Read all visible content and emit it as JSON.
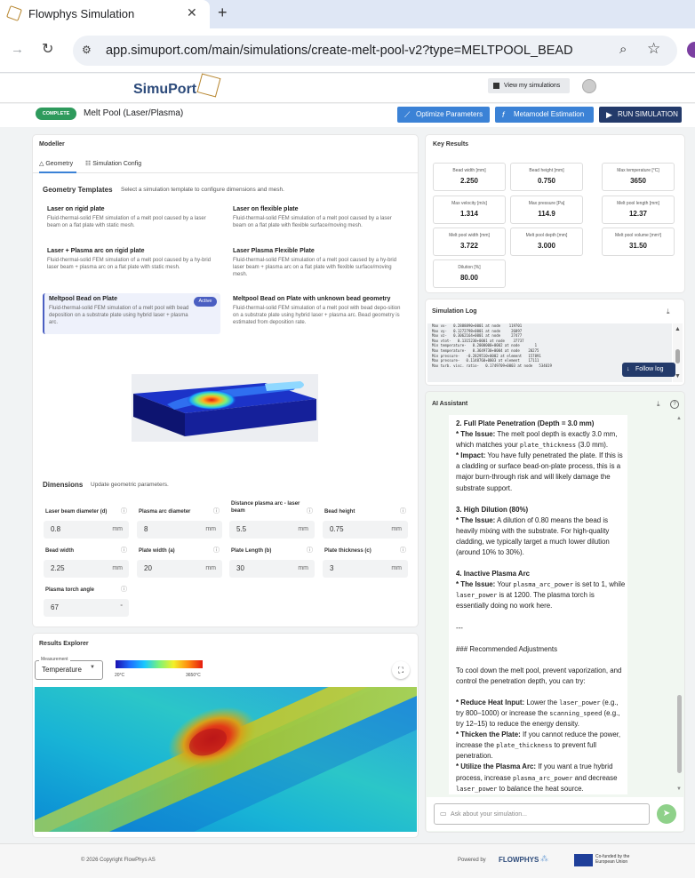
{
  "browser": {
    "tab_title": "Flowphys Simulation",
    "url": "app.simuport.com/main/simulations/create-melt-pool-v2?type=MELTPOOL_BEAD"
  },
  "header": {
    "logo": "SimuPort",
    "view_sims": "View my simulations"
  },
  "subheader": {
    "status": "COMPLETE",
    "name": "Melt Pool (Laser/Plasma)",
    "optimize": "Optimize Parameters",
    "metamodel": "Metamodel Estimation",
    "run": "RUN SIMULATION"
  },
  "modeller": {
    "title": "Modeller",
    "tabs": [
      "Geometry",
      "Simulation Config"
    ],
    "templates_title": "Geometry Templates",
    "templates_desc": "Select a simulation template to configure dimensions and mesh.",
    "templates": [
      {
        "title": "Laser on rigid plate",
        "desc": "Fluid-thermal-solid FEM simulation of a melt pool caused by a laser beam on a flat plate with static mesh."
      },
      {
        "title": "Laser on flexible plate",
        "desc": "Fluid-thermal-solid FEM simulation of a melt pool caused by a laser beam on a flat plate with flexible surface/moving mesh."
      },
      {
        "title": "Laser + Plasma arc on rigid plate",
        "desc": "Fluid-thermal-solid FEM simulation of a melt pool caused by a hy-brid laser beam + plasma arc on a flat plate with static mesh."
      },
      {
        "title": "Laser Plasma Flexible Plate",
        "desc": "Fluid-thermal-solid FEM simulation of a melt pool caused by a hy-brid laser beam + plasma arc on a flat plate with flexible surface/moving mesh."
      },
      {
        "title": "Meltpool Bead on Plate",
        "desc": "Fluid-thermal-solid FEM simulation of a melt pool with bead deposition on a substrate plate using hybrid laser + plasma arc."
      },
      {
        "title": "Meltpool Bead on Plate with unknown bead geometry",
        "desc": "Fluid-thermal-solid FEM simulation of a melt pool with bead depo-sition on a substrate plate using hybrid laser + plasma arc. Bead geometry is estimated from deposition rate."
      }
    ],
    "active_badge": "Active",
    "dims_title": "Dimensions",
    "dims_desc": "Update geometric parameters.",
    "fields": [
      {
        "label": "Laser beam diameter (d)",
        "value": "0.8",
        "unit": "mm"
      },
      {
        "label": "Plasma arc diameter",
        "value": "8",
        "unit": "mm"
      },
      {
        "label": "Distance plasma arc - laser beam",
        "value": "5.5",
        "unit": "mm"
      },
      {
        "label": "Bead height",
        "value": "0.75",
        "unit": "mm"
      },
      {
        "label": "Bead width",
        "value": "2.25",
        "unit": "mm"
      },
      {
        "label": "Plate width (a)",
        "value": "20",
        "unit": "mm"
      },
      {
        "label": "Plate Length (b)",
        "value": "30",
        "unit": "mm"
      },
      {
        "label": "Plate thickness (c)",
        "value": "3",
        "unit": "mm"
      },
      {
        "label": "Plasma torch angle",
        "value": "67",
        "unit": "°"
      }
    ]
  },
  "results": {
    "title": "Results Explorer",
    "measurement_label": "Measurement",
    "measurement": "Temperature",
    "min": "20°C",
    "max": "3650°C"
  },
  "key_results": {
    "title": "Key Results",
    "items": [
      {
        "label": "Bead width [mm]",
        "value": "2.250"
      },
      {
        "label": "Bead height [mm]",
        "value": "0.750"
      },
      {
        "label": "Max temperature [°C]",
        "value": "3650"
      },
      {
        "label": "Max velocity [m/s]",
        "value": "1.314"
      },
      {
        "label": "Max pressure [Pa]",
        "value": "114.9"
      },
      {
        "label": "Melt pool length [mm]",
        "value": "12.37"
      },
      {
        "label": "Melt pool width [mm]",
        "value": "3.722"
      },
      {
        "label": "Melt pool depth [mm]",
        "value": "3.000"
      },
      {
        "label": "Melt pool volume [mm³]",
        "value": "31.50"
      },
      {
        "label": "Dilution [%]",
        "value": "80.00"
      }
    ]
  },
  "sim_log": {
    "title": "Simulation Log",
    "lines": [
      "Max vx-   0.2888890+0001 at node    119701",
      "Max vy-   0.1272798+0001 at node     26897",
      "Max vz-   0.3062164+0001 at node     27477",
      "Max vtot-   0.1315230+0001 at node    37737",
      "Min temperature-   0.2000000+0002 at node       1",
      "Max temperature-   0.3649730+0004 at node    20275",
      "Min pressure-   -0.2829510+0002 at element   157891",
      "Max pressure-   0.1148760+0003 at element    17111",
      "Max turb. visc. ratio-   0.1749709+0003 at node   534019"
    ],
    "follow": "Follow log"
  },
  "ai": {
    "title": "AI Assistant",
    "placeholder": "Ask about your simulation...",
    "p1_head": "2. Full Plate Penetration (Depth = 3.0 mm)",
    "p1_issue_lbl": "* The Issue:",
    "p1_issue": " The melt pool depth is exactly 3.0 mm, which matches your ",
    "p1_code": "plate_thickness",
    "p1_issue_end": " (3.0 mm).",
    "p1_impact_lbl": "* Impact:",
    "p1_impact": " You have fully penetrated the plate. If this is a cladding or surface bead-on-plate process, this is a major burn-through risk and will likely damage the substrate support.",
    "p2_head": "3. High Dilution (80%)",
    "p2_issue_lbl": "* The Issue:",
    "p2_issue": " A dilution of 0.80 means the bead is heavily mixing with the substrate. For high-quality cladding, we typically target a much lower dilution (around 10% to 30%).",
    "p3_head": "4. Inactive Plasma Arc",
    "p3_issue_lbl": "* The Issue:",
    "p3_a": " Your ",
    "p3_code1": "plasma_arc_power",
    "p3_b": " is set to 1, while ",
    "p3_code2": "laser_power",
    "p3_c": " is at 1200. The plasma torch is essentially doing no work here.",
    "sep": "---",
    "rec_head": "### Recommended Adjustments",
    "rec_intro": "To cool down the melt pool, prevent vaporization, and control the penetration depth, you can try:",
    "r1_lbl": "* Reduce Heat Input:",
    "r1_a": " Lower the ",
    "r1_code1": "laser_power",
    "r1_b": " (e.g., try 800–1000) or increase the ",
    "r1_code2": "scanning_speed",
    "r1_c": " (e.g., try 12–15) to reduce the energy density.",
    "r2_lbl": "* Thicken the Plate:",
    "r2_a": " If you cannot reduce the power, increase the ",
    "r2_code": "plate_thickness",
    "r2_b": " to prevent full penetration.",
    "r3_lbl": "* Utilize the Plasma Arc:",
    "r3_a": " If you want a true hybrid process, increase ",
    "r3_code1": "plasma_arc_power",
    "r3_b": " and decrease ",
    "r3_code2": "laser_power",
    "r3_c": " to balance the heat source."
  },
  "footer": {
    "copyright": "© 2026 Copyright FlowPhys AS",
    "powered": "Powered by",
    "brand": "FLOWPHYS",
    "eu": "Co-funded by the European Union"
  },
  "colors": {
    "accent": "#3b82d6",
    "dark": "#233a6a",
    "success": "#2e9a5c",
    "active": "#4b5fc2"
  }
}
